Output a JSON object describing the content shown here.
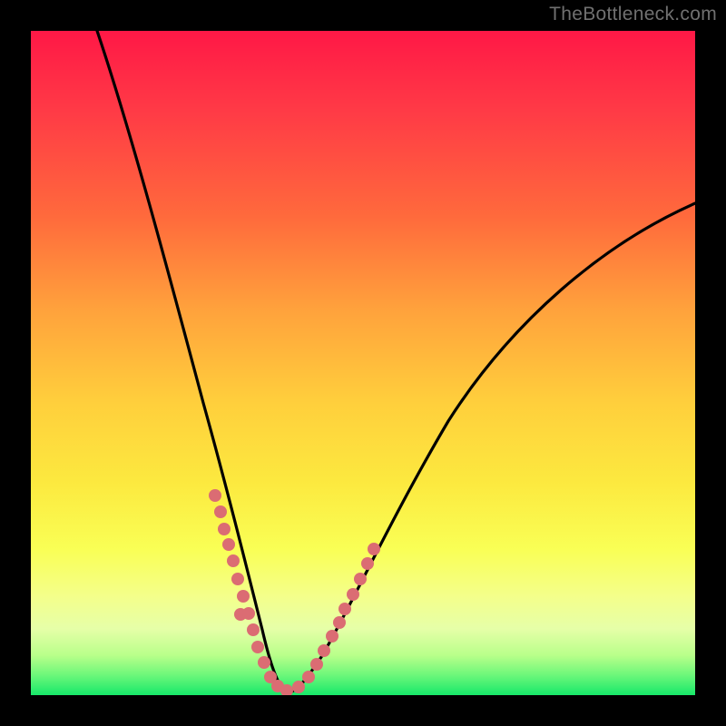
{
  "watermark": "TheBottleneck.com",
  "chart_data": {
    "type": "line",
    "title": "",
    "xlabel": "",
    "ylabel": "",
    "xlim": [
      0,
      100
    ],
    "ylim": [
      0,
      100
    ],
    "series": [
      {
        "name": "curve-left-branch",
        "x": [
          10,
          14,
          18,
          22,
          25,
          27,
          29,
          31,
          32,
          33,
          34,
          35,
          36
        ],
        "y": [
          100,
          86,
          70,
          52,
          38,
          30,
          22,
          14,
          10,
          7,
          5,
          3,
          2
        ]
      },
      {
        "name": "curve-right-branch",
        "x": [
          36,
          40,
          44,
          48,
          55,
          65,
          75,
          85,
          95,
          100
        ],
        "y": [
          2,
          5,
          12,
          20,
          35,
          50,
          60,
          67,
          72,
          74
        ]
      }
    ],
    "dot_clusters": {
      "left_branch": {
        "x_range": [
          27,
          36
        ],
        "y_range": [
          2,
          30
        ],
        "approx_count": 14
      },
      "right_branch": {
        "x_range": [
          36,
          48
        ],
        "y_range": [
          2,
          20
        ],
        "approx_count": 12
      }
    },
    "colors": {
      "curve": "#000000",
      "dots": "#db6c73",
      "gradient_top": "#ff1846",
      "gradient_mid": "#ffd23c",
      "gradient_bottom": "#17e86a",
      "background": "#000000",
      "watermark": "#707070"
    }
  }
}
